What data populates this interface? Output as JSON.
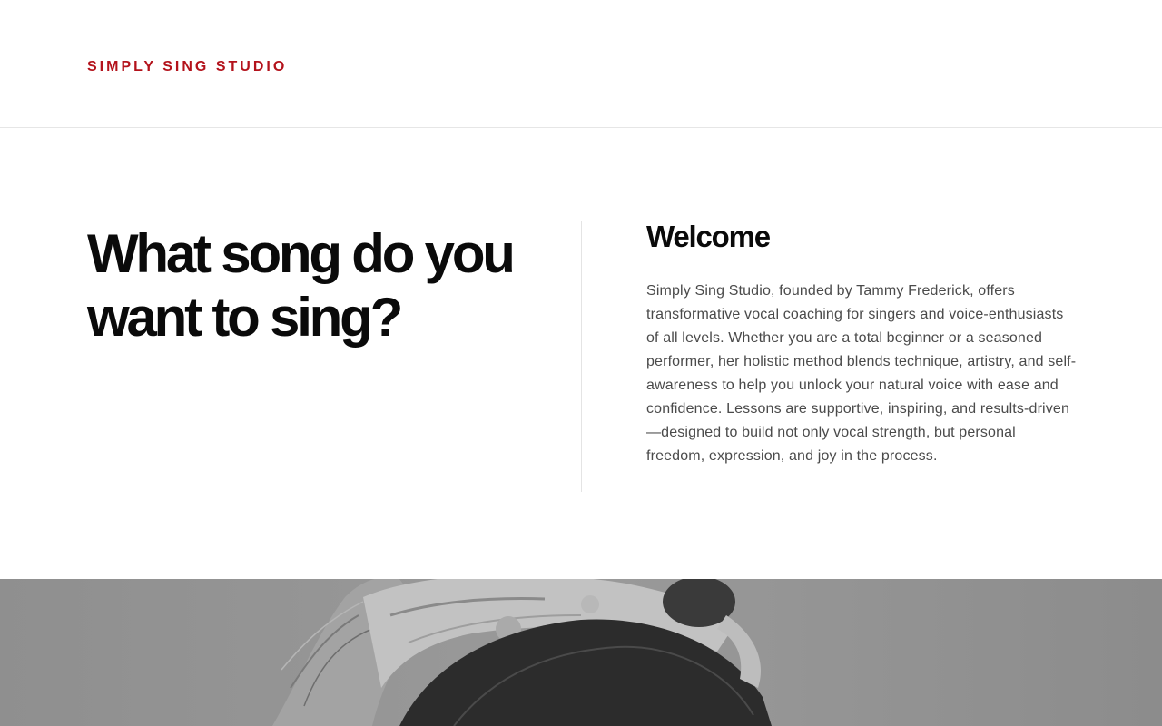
{
  "header": {
    "brand": "SIMPLY SING STUDIO",
    "brand_color": "#b3121b"
  },
  "hero": {
    "headline": "What song do you want to sing?",
    "welcome_title": "Welcome",
    "welcome_body": "Simply Sing Studio, founded by Tammy Frederick, offers transformative vocal coaching for singers and voice-enthusiasts of all levels. Whether you are a total beginner or a seasoned performer, her holistic method blends technique, artistry, and self-awareness to help you unlock your natural voice with ease and confidence. Lessons are supportive, inspiring, and results-driven—designed to build not only vocal strength, but personal freedom, expression, and joy in the process."
  },
  "photo": {
    "icon": "portrait-photo",
    "tone": "grayscale"
  }
}
